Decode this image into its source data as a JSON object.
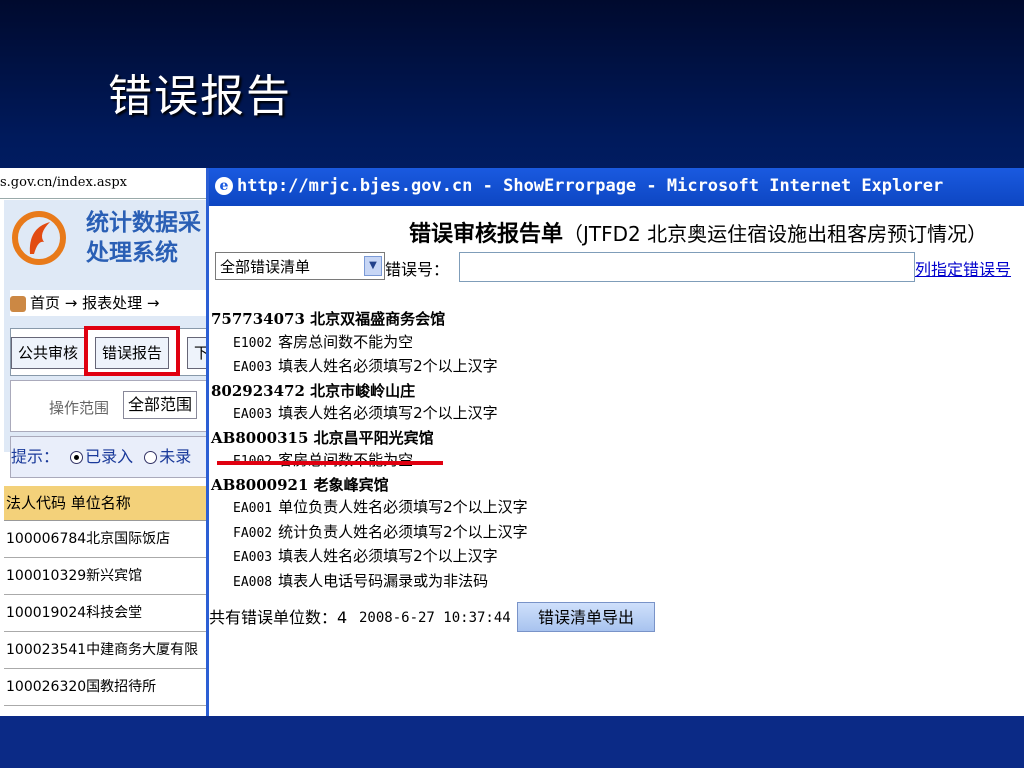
{
  "slide": {
    "title": "错误报告"
  },
  "background_window": {
    "url": "s.gov.cn/index.aspx",
    "system_name_line1": "统计数据采",
    "system_name_line2": "处理系统",
    "nav": "首页 → 报表处理 →",
    "tabs": [
      "公共审核",
      "错误报告",
      "下"
    ],
    "range_label": "操作范围",
    "range_value": "全部范围",
    "hint_label": "提示：",
    "hint_opt1": "已录入",
    "hint_opt2": "未录",
    "table_header": "法人代码 单位名称",
    "rows": [
      {
        "code": "100006784",
        "name": "北京国际饭店"
      },
      {
        "code": "100010329",
        "name": "新兴宾馆"
      },
      {
        "code": "100019024",
        "name": "科技会堂"
      },
      {
        "code": "100023541",
        "name": "中建商务大厦有限"
      },
      {
        "code": "100026320",
        "name": "国教招待所"
      }
    ]
  },
  "ie_window": {
    "title": "http://mrjc.bjes.gov.cn - ShowErrorpage - Microsoft Internet Explorer",
    "report_title": "错误审核报告单",
    "report_subtitle": "（JTFD2 北京奥运住宿设施出租客房预订情况）",
    "filter_value": "全部错误清单",
    "errno_label": "错误号：",
    "errno_value": "",
    "assign_link": "列指定错误号",
    "units": [
      {
        "code": "757734073",
        "name": "北京双福盛商务会馆",
        "errors": [
          {
            "code": "E1002",
            "msg": "客房总间数不能为空"
          },
          {
            "code": "EA003",
            "msg": "填表人姓名必须填写2个以上汉字"
          }
        ]
      },
      {
        "code": "802923472",
        "name": "北京市峻岭山庄",
        "errors": [
          {
            "code": "EA003",
            "msg": "填表人姓名必须填写2个以上汉字"
          }
        ]
      },
      {
        "code": "AB8000315",
        "name": "北京昌平阳光宾馆",
        "errors": [
          {
            "code": "E1002",
            "msg": "客房总间数不能为空"
          }
        ]
      },
      {
        "code": "AB8000921",
        "name": "老象峰宾馆",
        "errors": [
          {
            "code": "EA001",
            "msg": "单位负责人姓名必须填写2个以上汉字"
          },
          {
            "code": "FA002",
            "msg": "统计负责人姓名必须填写2个以上汉字"
          },
          {
            "code": "EA003",
            "msg": "填表人姓名必须填写2个以上汉字"
          },
          {
            "code": "EA008",
            "msg": "填表人电话号码漏录或为非法码"
          }
        ]
      }
    ],
    "summary_label": "共有错误单位数：",
    "summary_count": "4",
    "timestamp": "2008-6-27 10:37:44",
    "export_button": "错误清单导出"
  },
  "colors": {
    "highlight": "#e00010",
    "title_bar": "#1a5ae0"
  }
}
